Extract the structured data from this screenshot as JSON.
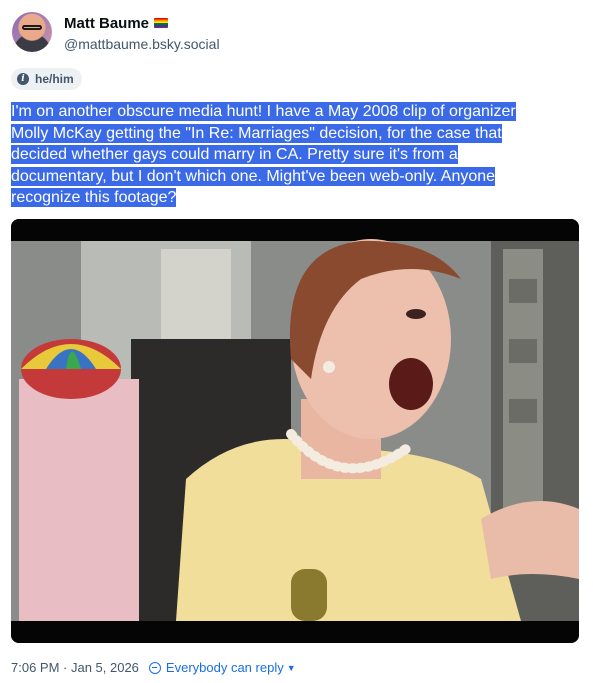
{
  "author": {
    "display_name": "Matt Baume",
    "handle": "@mattbaume.bsky.social",
    "flag_icon": "rainbow-flag-icon"
  },
  "pronouns": {
    "label": "he/him",
    "icon": "info-icon"
  },
  "post": {
    "text_lines": [
      "I'm on another obscure media hunt! I have a May 2008 clip of organizer",
      "Molly McKay getting the \"In Re: Marriages\" decision, for the case that",
      "decided whether gays could marry in CA. Pretty sure it's from a",
      "documentary, but I don't which one. Might've been web-only. Anyone",
      "recognize this footage?"
    ],
    "highlight_color": "#3b6ae8"
  },
  "media": {
    "kind": "video-frame",
    "description_icon": "video-thumbnail"
  },
  "footer": {
    "timestamp": "7:06 PM · Jan 5, 2026",
    "reply_setting": "Everybody can reply",
    "reply_icon": "globe-icon",
    "chevron_icon": "chevron-down-icon",
    "accent_color": "#1a6ee8"
  }
}
